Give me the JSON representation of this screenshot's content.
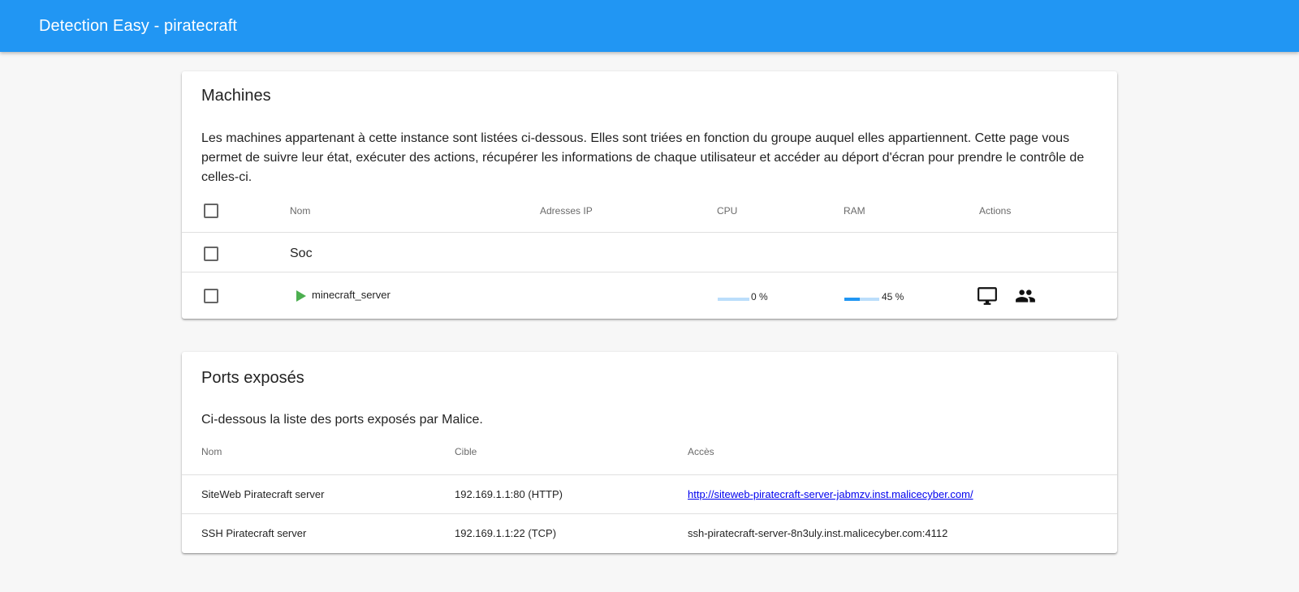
{
  "app": {
    "title": "Detection Easy - piratecraft"
  },
  "machines": {
    "title": "Machines",
    "description": "Les machines appartenant à cette instance sont listées ci-dessous. Elles sont triées en fonction du groupe auquel elles appartiennent. Cette page vous permet de suivre leur état, exécuter des actions, récupérer les informations de chaque utilisateur et accéder au déport d'écran pour prendre le contrôle de celles-ci.",
    "headers": {
      "name": "Nom",
      "ips": "Adresses IP",
      "cpu": "CPU",
      "ram": "RAM",
      "actions": "Actions"
    },
    "groups": [
      {
        "name": "Soc",
        "machines": [
          {
            "name": "minecraft_server",
            "ip": "",
            "cpu": {
              "percent": 0,
              "label": "0 %"
            },
            "ram": {
              "percent": 45,
              "label": "45 %"
            },
            "status_icon": "play-icon",
            "actions": [
              "monitor-icon",
              "users-icon"
            ]
          }
        ]
      }
    ]
  },
  "ports": {
    "title": "Ports exposés",
    "description": "Ci-dessous la liste des ports exposés par Malice.",
    "headers": {
      "name": "Nom",
      "target": "Cible",
      "access": "Accès"
    },
    "rows": [
      {
        "name": "SiteWeb Piratecraft server",
        "target": "192.169.1.1:80 (HTTP)",
        "access": "http://siteweb-piratecraft-server-jabmzv.inst.malicecyber.com/",
        "is_link": true
      },
      {
        "name": "SSH Piratecraft server",
        "target": "192.169.1.1:22 (TCP)",
        "access": "ssh-piratecraft-server-8n3uly.inst.malicecyber.com:4112",
        "is_link": false
      }
    ]
  },
  "colors": {
    "accent": "#2196f3",
    "status_running": "#4caf50",
    "bar_track": "#bbdefb"
  }
}
